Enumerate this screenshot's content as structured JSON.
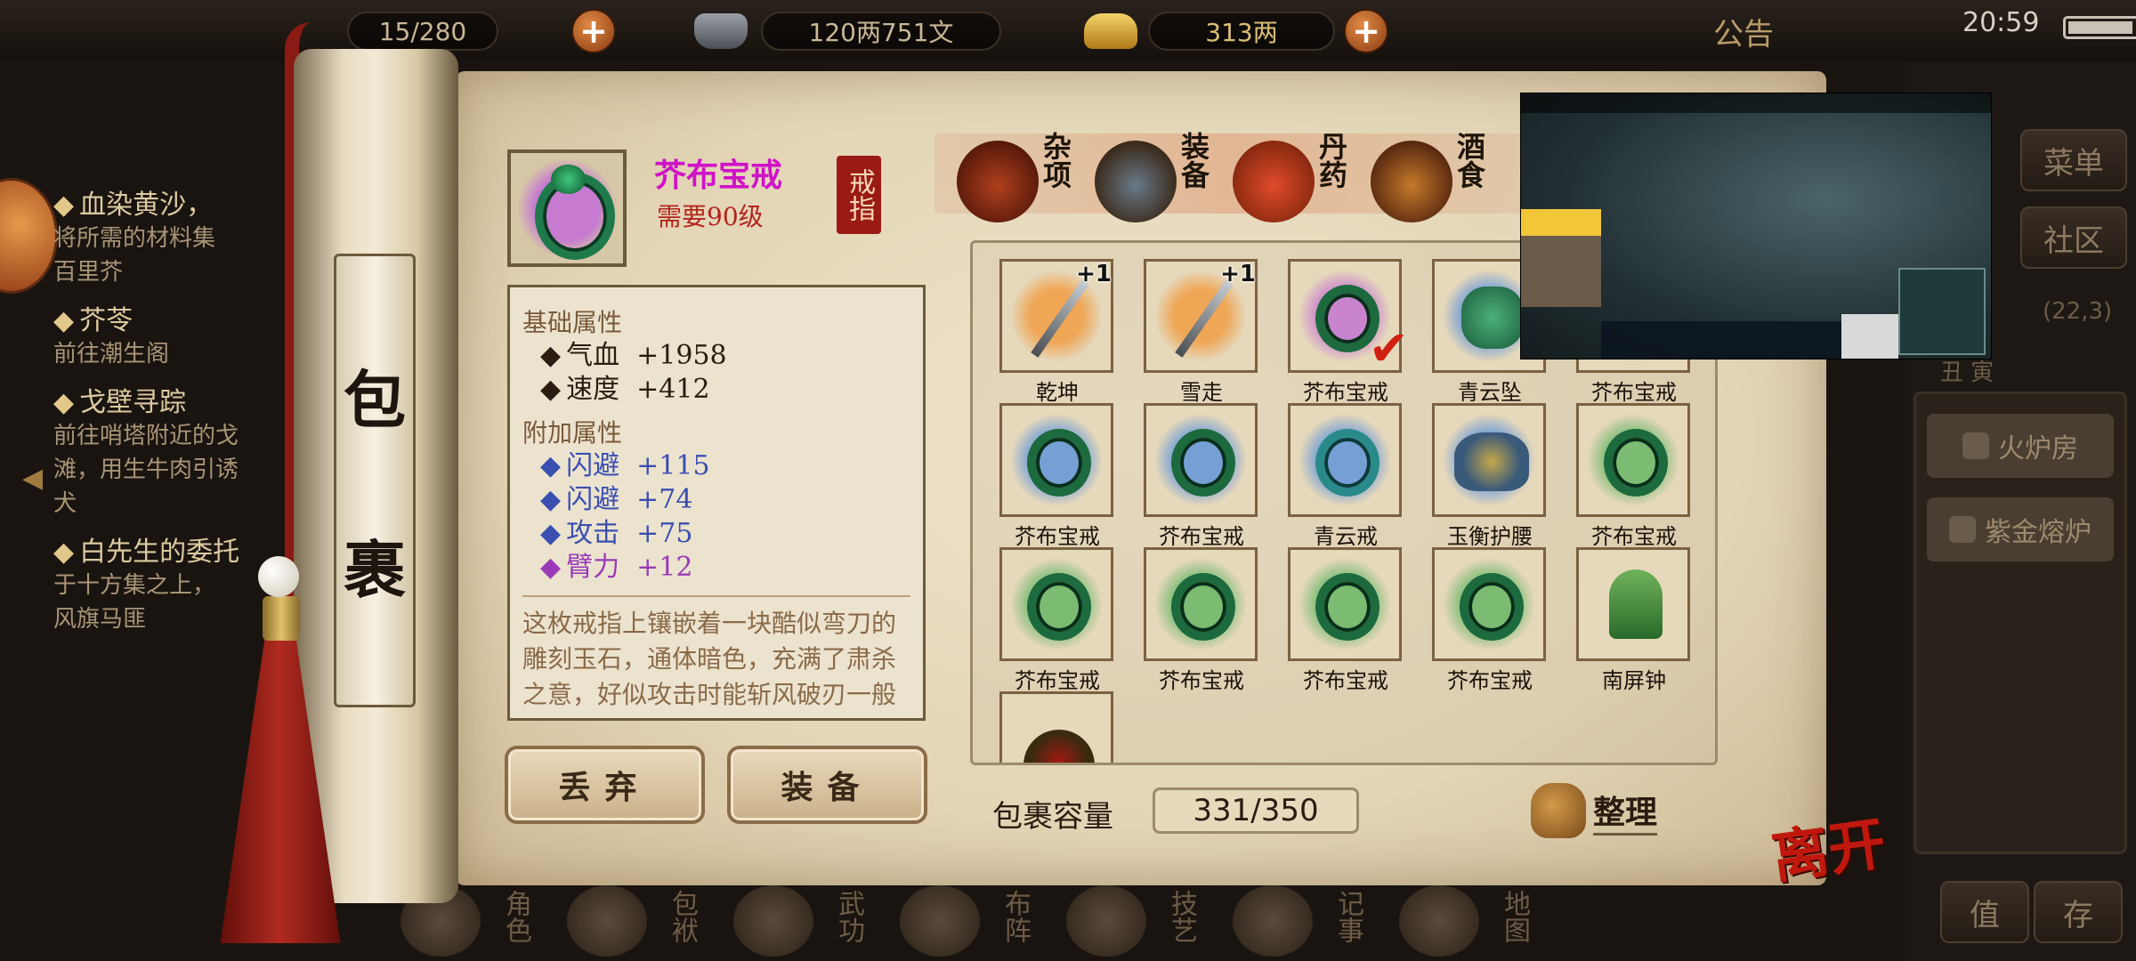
{
  "topbar": {
    "stamina_value": "15/280",
    "silver_value": "120两751文",
    "gold_value": "313两",
    "notice_label": "公告",
    "clock": "20:59"
  },
  "quests": [
    {
      "title": "血染黄沙，",
      "desc": "将所需的材料集\n百里芥"
    },
    {
      "title": "芥苓",
      "desc": "前往潮生阁"
    },
    {
      "title": "戈壁寻踪",
      "desc": "前往哨塔附近的戈\n滩，用生牛肉引诱\n犬"
    },
    {
      "title": "白先生的委托",
      "desc": "于十方集之上，\n风旗马匪"
    }
  ],
  "side_menu": {
    "menu_label": "菜单",
    "community_label": "社区",
    "coord": "(22,3)",
    "time_labels": "丑 寅",
    "entries": [
      "火炉房",
      "紫金熔炉"
    ],
    "bottom_left": "值",
    "bottom_right": "存"
  },
  "bottom_nav": [
    {
      "label": "角色"
    },
    {
      "label": "包袱"
    },
    {
      "label": "武功"
    },
    {
      "label": "布阵"
    },
    {
      "label": "技艺"
    },
    {
      "label": "记事"
    },
    {
      "label": "地图"
    }
  ],
  "scroll_title": [
    "包",
    "裹"
  ],
  "item": {
    "name": "芥布宝戒",
    "requirement": "需要90级",
    "type": "戒指",
    "base_header": "基础属性",
    "base_attrs": [
      {
        "label": "气血",
        "value": "+1958"
      },
      {
        "label": "速度",
        "value": "+412"
      }
    ],
    "extra_header": "附加属性",
    "extra_attrs": [
      {
        "label": "闪避",
        "value": "+115",
        "color": "#3a4fb0"
      },
      {
        "label": "闪避",
        "value": "+74",
        "color": "#3a4fb0"
      },
      {
        "label": "攻击",
        "value": "+75",
        "color": "#3a4fb0"
      },
      {
        "label": "臂力",
        "value": "+12",
        "color": "#9a3ab8"
      }
    ],
    "description": "这枚戒指上镶嵌着一块酷似弯刀的雕刻玉石，通体暗色，充满了肃杀之意，好似攻击时能斩风破刃一般",
    "name_color": "#d012c8"
  },
  "actions": {
    "discard": "丢弃",
    "equip": "装备"
  },
  "categories": [
    {
      "label": "杂项",
      "icon": "jar-icon"
    },
    {
      "label": "装备",
      "icon": "equipment-icon"
    },
    {
      "label": "丹药",
      "icon": "pill-icon"
    },
    {
      "label": "酒食",
      "icon": "food-icon"
    }
  ],
  "inventory": [
    {
      "name": "乾坤",
      "icon": "sword-icon",
      "plus": "+1",
      "bg": "#f0a04a"
    },
    {
      "name": "雪走",
      "icon": "sword-icon",
      "plus": "+1",
      "bg": "#f0a04a"
    },
    {
      "name": "芥布宝戒",
      "icon": "ring-icon",
      "equipped": true,
      "bg": "#c67ad0"
    },
    {
      "name": "青云坠",
      "icon": "pendant-icon",
      "bg": "#6a9ad8"
    },
    {
      "name": "芥布宝戒",
      "icon": "ring-icon",
      "bg": "#6fb86a"
    },
    {
      "name": "芥布宝戒",
      "icon": "ring-icon",
      "bg": "#6a9ad8"
    },
    {
      "name": "芥布宝戒",
      "icon": "ring-icon",
      "bg": "#6a9ad8"
    },
    {
      "name": "青云戒",
      "icon": "ring-teal-icon",
      "bg": "#6a9ad8"
    },
    {
      "name": "玉衡护腰",
      "icon": "belt-icon",
      "bg": "#6a9ad8"
    },
    {
      "name": "芥布宝戒",
      "icon": "ring-icon",
      "bg": "#6fb86a"
    },
    {
      "name": "芥布宝戒",
      "icon": "ring-icon",
      "bg": "#6fb86a"
    },
    {
      "name": "芥布宝戒",
      "icon": "ring-icon",
      "bg": "#6fb86a"
    },
    {
      "name": "芥布宝戒",
      "icon": "ring-icon",
      "bg": "#6fb86a"
    },
    {
      "name": "芥布宝戒",
      "icon": "ring-icon",
      "bg": "#6fb86a"
    },
    {
      "name": "南屏钟",
      "icon": "bell-icon",
      "bg": "#e6d8bb"
    },
    {
      "name": "",
      "icon": "helmet-icon",
      "bg": "#e6d8bb"
    }
  ],
  "capacity": {
    "label": "包裹容量",
    "value": "331/350"
  },
  "sort_label": "整理",
  "leave_label": "离开"
}
